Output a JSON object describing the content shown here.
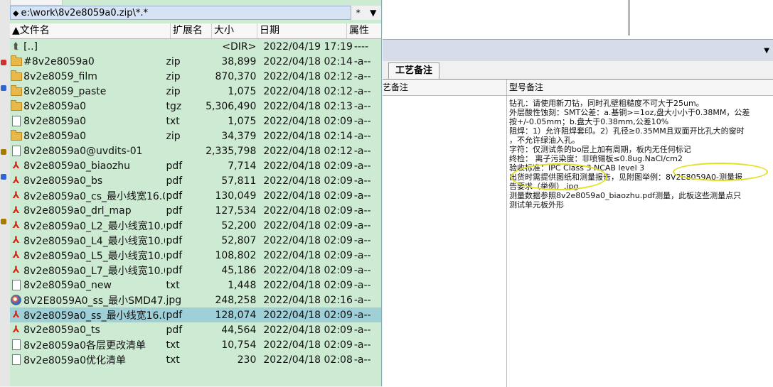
{
  "path": {
    "text": "e:\\work\\8v2e8059a0.zip\\*.*",
    "filter": "*"
  },
  "headers": {
    "name": "文件名",
    "ext": "扩展名",
    "size": "大小",
    "date": "日期",
    "attr": "属性"
  },
  "files": [
    {
      "icon": "up",
      "name": "[..]",
      "ext": "",
      "size": "<DIR>",
      "date": "2022/04/19 17:19",
      "attr": "----"
    },
    {
      "icon": "folder",
      "name": "#8v2e8059a0",
      "ext": "zip",
      "size": "38,899",
      "date": "2022/04/18 02:14",
      "attr": "-a--"
    },
    {
      "icon": "folder",
      "name": "8v2e8059_film",
      "ext": "zip",
      "size": "870,370",
      "date": "2022/04/18 02:12",
      "attr": "-a--"
    },
    {
      "icon": "folder",
      "name": "8v2e8059_paste",
      "ext": "zip",
      "size": "1,075",
      "date": "2022/04/18 02:12",
      "attr": "-a--"
    },
    {
      "icon": "folder",
      "name": "8v2e8059a0",
      "ext": "tgz",
      "size": "5,306,490",
      "date": "2022/04/18 02:13",
      "attr": "-a--"
    },
    {
      "icon": "doc",
      "name": "8v2e8059a0",
      "ext": "txt",
      "size": "1,075",
      "date": "2022/04/18 02:09",
      "attr": "-a--"
    },
    {
      "icon": "folder",
      "name": "8v2e8059a0",
      "ext": "zip",
      "size": "34,379",
      "date": "2022/04/18 02:14",
      "attr": "-a--"
    },
    {
      "icon": "doc",
      "name": "8v2e8059a0@uvdits-01",
      "ext": "",
      "size": "2,335,798",
      "date": "2022/04/18 02:12",
      "attr": "-a--"
    },
    {
      "icon": "pdf",
      "name": "8v2e8059a0_biaozhu",
      "ext": "pdf",
      "size": "7,714",
      "date": "2022/04/18 02:09",
      "attr": "-a--"
    },
    {
      "icon": "pdf",
      "name": "8v2e8059a0_bs",
      "ext": "pdf",
      "size": "57,811",
      "date": "2022/04/18 02:09",
      "attr": "-a--"
    },
    {
      "icon": "pdf",
      "name": "8v2e8059a0_cs_最小线宽16.0..",
      "ext": "pdf",
      "size": "130,049",
      "date": "2022/04/18 02:09",
      "attr": "-a--"
    },
    {
      "icon": "pdf",
      "name": "8v2e8059a0_drl_map",
      "ext": "pdf",
      "size": "127,534",
      "date": "2022/04/18 02:09",
      "attr": "-a--"
    },
    {
      "icon": "pdf",
      "name": "8v2e8059a0_L2_最小线宽10.0..",
      "ext": "pdf",
      "size": "52,200",
      "date": "2022/04/18 02:09",
      "attr": "-a--"
    },
    {
      "icon": "pdf",
      "name": "8v2e8059a0_L4_最小线宽10.0..",
      "ext": "pdf",
      "size": "52,807",
      "date": "2022/04/18 02:09",
      "attr": "-a--"
    },
    {
      "icon": "pdf",
      "name": "8v2e8059a0_L5_最小线宽10.0..",
      "ext": "pdf",
      "size": "108,802",
      "date": "2022/04/18 02:09",
      "attr": "-a--"
    },
    {
      "icon": "pdf",
      "name": "8v2e8059a0_L7_最小线宽10.0..",
      "ext": "pdf",
      "size": "45,186",
      "date": "2022/04/18 02:09",
      "attr": "-a--"
    },
    {
      "icon": "doc",
      "name": "8v2e8059a0_new",
      "ext": "txt",
      "size": "1,448",
      "date": "2022/04/18 02:09",
      "attr": "-a--"
    },
    {
      "icon": "img",
      "name": "8V2E8059A0_ss_最小SMD47...",
      "ext": "jpg",
      "size": "248,258",
      "date": "2022/04/18 02:16",
      "attr": "-a--"
    },
    {
      "icon": "pdf",
      "name": "8v2e8059a0_ss_最小线宽16.0..",
      "ext": "pdf",
      "size": "128,074",
      "date": "2022/04/18 02:09",
      "attr": "-a--",
      "selected": true
    },
    {
      "icon": "pdf",
      "name": "8v2e8059a0_ts",
      "ext": "pdf",
      "size": "44,564",
      "date": "2022/04/18 02:09",
      "attr": "-a--"
    },
    {
      "icon": "doc",
      "name": "8v2e8059a0各层更改清单",
      "ext": "txt",
      "size": "10,754",
      "date": "2022/04/18 02:09",
      "attr": "-a--"
    },
    {
      "icon": "doc",
      "name": "8v2e8059a0优化清单",
      "ext": "txt",
      "size": "230",
      "date": "2022/04/18 02:08",
      "attr": "-a--"
    }
  ],
  "right": {
    "tab_label": "工艺备注",
    "col1_header": "艺备注",
    "col2_header": "型号备注",
    "notes": [
      "钻孔：请使用新刀钻，同时孔壁粗糙度不可大于25um。",
      "外层酸性蚀刻：SMT公差：a.基铜>=1oz,盘大小小于0.38MM，公差",
      "按+/-0.05mm；b.盘大于0.38mm,公差10%",
      "阻焊：1）允许阻焊套印。2）孔径≥0.35MM且双面开比孔大的窗时",
      "，不允许绿油入孔。",
      "字符：仅测试条的bo层上加有周期，板内无任何标记",
      "终检：  离子污染度：非喷锡板≤0.8ug.NaCl/cm2",
      "验收标准：IPC Class 3 NCAB level 3",
      "出货时需提供图纸和测量报告，见附图举例：8V2E8059A0-测量报",
      "告要求（举例）.jpg",
      "测量数据参照8v2e8059a0_biaozhu.pdf测量，此板这些测量点只",
      "测试单元板外形"
    ]
  },
  "colors": {
    "panel_bg": "#cdebd3",
    "selected_row": "#9fd0d8",
    "highlight_circle": "#e2e022"
  }
}
